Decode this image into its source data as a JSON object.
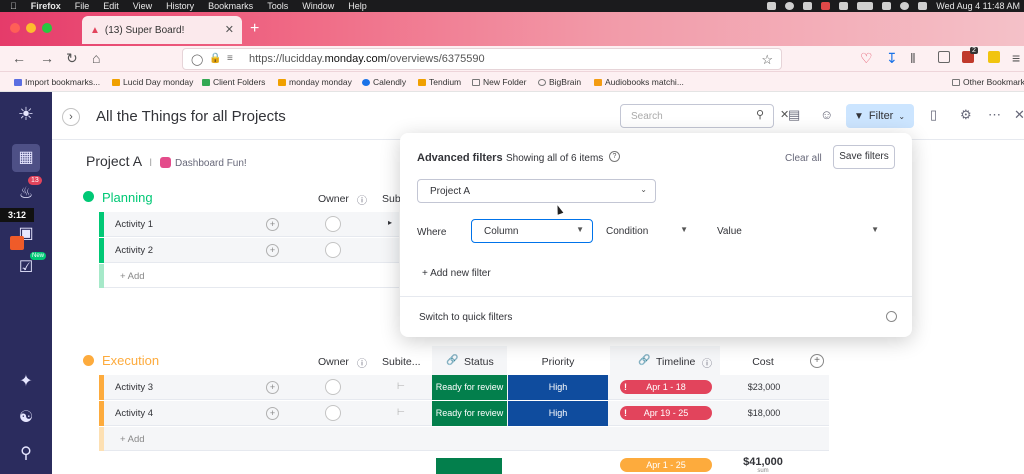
{
  "menubar": {
    "apple": "",
    "items": [
      "Firefox",
      "File",
      "Edit",
      "View",
      "History",
      "Bookmarks",
      "Tools",
      "Window",
      "Help"
    ],
    "clock": "Wed Aug 4  11:48 AM"
  },
  "browser": {
    "tab_title": "(13) Super Board!",
    "new_tab": "+",
    "url_prefix": "https://lucidday.",
    "url_domain": "monday.com",
    "url_path": "/overviews/6375590",
    "bookmarks": [
      {
        "label": "Import bookmarks...",
        "icon": "import-icon",
        "color": "#5b6ee1"
      },
      {
        "label": "Lucid Day monday",
        "icon": "monday-icon",
        "color": "#f0a000"
      },
      {
        "label": "Client Folders",
        "icon": "drive-icon",
        "color": "#34a853"
      },
      {
        "label": "monday monday",
        "icon": "monday-icon",
        "color": "#f0a000"
      },
      {
        "label": "Calendly",
        "icon": "calendly-icon",
        "color": "#1a73e8"
      },
      {
        "label": "Tendium",
        "icon": "monday-icon",
        "color": "#f0a000"
      },
      {
        "label": "New Folder",
        "icon": "folder-icon",
        "color": "#777"
      },
      {
        "label": "BigBrain",
        "icon": "brain-icon",
        "color": "#777"
      },
      {
        "label": "Audiobooks matchi...",
        "icon": "audible-icon",
        "color": "#f39c12"
      }
    ],
    "other_bookmarks": "Other Bookmarks",
    "ext_badge": "2"
  },
  "rail": {
    "timer": "3:12",
    "notif_count": "13",
    "new_label": "New"
  },
  "board": {
    "title": "All the Things for all Projects",
    "search_placeholder": "Search",
    "filter_label": "Filter",
    "project": "Project A",
    "project_sep": "I",
    "dashboard_link": "Dashboard Fun!",
    "planning": {
      "name": "Planning",
      "color": "#00c875",
      "col_owner": "Owner",
      "col_sub": "Subi",
      "rows": [
        "Activity 1",
        "Activity 2"
      ],
      "add": "+ Add"
    },
    "execution": {
      "name": "Execution",
      "color": "#fdab3d",
      "col_owner": "Owner",
      "col_subitems": "Subite...",
      "col_status": "Status",
      "col_priority": "Priority",
      "col_timeline": "Timeline",
      "col_cost": "Cost",
      "rows": [
        {
          "name": "Activity 3",
          "status": "Ready for review",
          "priority": "High",
          "timeline": "Apr 1 - 18",
          "cost": "$23,000"
        },
        {
          "name": "Activity 4",
          "status": "Ready for review",
          "priority": "High",
          "timeline": "Apr 19 - 25",
          "cost": "$18,000"
        }
      ],
      "add": "+ Add",
      "summary_timeline": "Apr 1 - 25",
      "summary_cost": "$41,000",
      "summary_cost_label": "sum"
    },
    "colors": {
      "status_green": "#037f4c",
      "priority_blue": "#0f4c9e",
      "timeline_red": "#e2445c",
      "timeline_orange": "#fdab3d"
    }
  },
  "filter_popover": {
    "title": "Advanced filters",
    "subtitle": "Showing all of 6 items",
    "clear_all": "Clear all",
    "save_filters": "Save filters",
    "board_select": "Project A",
    "where": "Where",
    "column": "Column",
    "condition": "Condition",
    "value": "Value",
    "add_filter": "+ Add new filter",
    "switch": "Switch to quick filters"
  }
}
